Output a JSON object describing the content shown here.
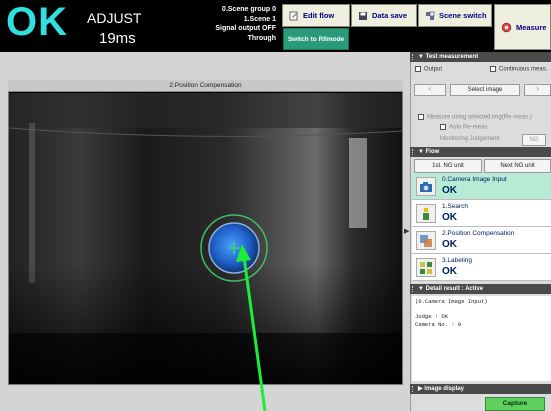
{
  "status": {
    "result": "OK",
    "mode": "ADJUST",
    "time": "19ms"
  },
  "scene": {
    "group": "0.Scene group 0",
    "scene": "1.Scene 1",
    "signal": "Signal output OFF",
    "through": "Through"
  },
  "toolbar": {
    "edit_flow": "Edit flow",
    "data_save": "Data save",
    "scene_switch": "Scene switch",
    "measure": "Measure",
    "switch_mode": "Switch to Rllmode"
  },
  "image_window": {
    "title": "2.Position Compensation"
  },
  "test_measurement": {
    "header": "Test measurement",
    "output_label": "Output",
    "continuous_label": "Continuous meas.",
    "select_image": "Select image",
    "measure_using": "Measure using selected img(Re-meas.)",
    "auto_remeas": "Auto Re-meas.",
    "monitoring_judgement": "Monitoring Judgement",
    "monitoring_value": "NG"
  },
  "flow": {
    "header": "Flow",
    "first_ng": "1st. NG unit",
    "next_ng": "Next NG unit",
    "items": [
      {
        "name": "0.Camera Image Input",
        "status": "OK"
      },
      {
        "name": "1.Search",
        "status": "OK"
      },
      {
        "name": "2.Position Compensation",
        "status": "OK"
      },
      {
        "name": "3.Labeling",
        "status": "OK"
      }
    ]
  },
  "detail": {
    "header": "Detail result : Active",
    "text": "(0.Camera Image Input)\n\nJudge : OK\nCamera No. : 0"
  },
  "image_display": {
    "header": "Image display"
  },
  "capture_button": "Capture",
  "colors": {
    "ok_cyan": "#30e0e0",
    "selected_row": "#b9ead5",
    "capture_green": "#5fcf5f"
  }
}
